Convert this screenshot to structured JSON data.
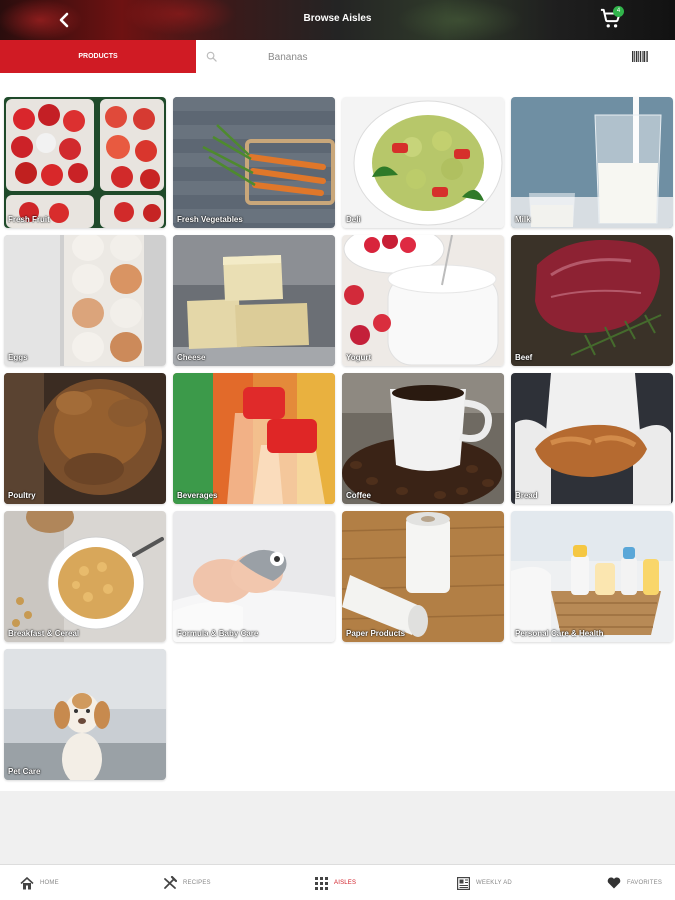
{
  "header": {
    "title": "Browse Aisles",
    "back_icon": "chevron-left-icon",
    "cart_icon": "shopping-cart-icon",
    "cart_count": "4"
  },
  "search": {
    "tab_label": "PRODUCTS",
    "placeholder": "Bananas",
    "search_icon": "magnifier-icon",
    "barcode_icon": "barcode-icon"
  },
  "aisles": [
    {
      "label": "Fresh Fruit"
    },
    {
      "label": "Fresh Vegetables"
    },
    {
      "label": "Deli"
    },
    {
      "label": "Milk"
    },
    {
      "label": "Eggs"
    },
    {
      "label": "Cheese"
    },
    {
      "label": "Yogurt"
    },
    {
      "label": "Beef"
    },
    {
      "label": "Poultry"
    },
    {
      "label": "Beverages"
    },
    {
      "label": "Coffee"
    },
    {
      "label": "Bread"
    },
    {
      "label": "Breakfast & Cereal"
    },
    {
      "label": "Formula & Baby Care"
    },
    {
      "label": "Paper Products"
    },
    {
      "label": "Personal Care & Health"
    },
    {
      "label": "Pet Care"
    }
  ],
  "bottom_nav": {
    "home": "HOME",
    "recipes": "RECIPES",
    "aisles": "AISLES",
    "weekly_ad": "WEEKLY AD",
    "favorites": "FAVORITES",
    "active": "AISLES"
  },
  "colors": {
    "brand_red": "#d01b24",
    "badge_green": "#31b44b"
  }
}
